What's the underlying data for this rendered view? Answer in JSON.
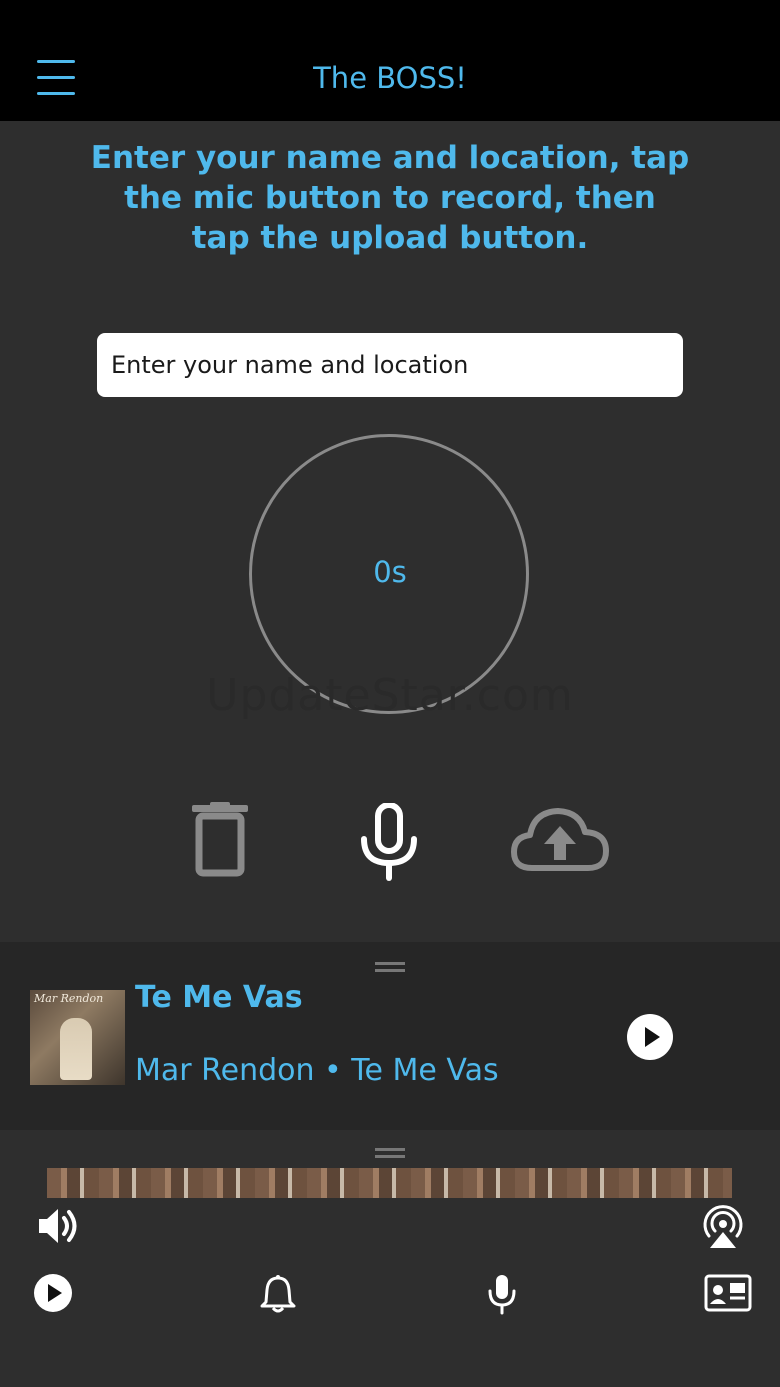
{
  "app": {
    "title": "The BOSS!"
  },
  "recorder": {
    "instructions": "Enter your name and location, tap the mic button to record, then tap the upload button.",
    "name_placeholder": "Enter your name and location",
    "timer": "0s",
    "watermark": "UpdateStar.com"
  },
  "now_playing": {
    "title": "Te Me Vas",
    "artist_line": "Mar Rendon • Te Me Vas",
    "art_signature": "Mar Rendon"
  },
  "icons": {
    "menu": "hamburger-menu-icon",
    "trash": "trash-icon",
    "mic": "microphone-icon",
    "upload": "cloud-upload-icon",
    "play": "play-icon",
    "volume": "volume-icon",
    "airplay": "airplay-icon",
    "bell": "bell-icon",
    "contact": "contact-card-icon"
  },
  "colors": {
    "accent": "#4fb9ec",
    "background": "#2e2e2e",
    "header": "#000000"
  }
}
